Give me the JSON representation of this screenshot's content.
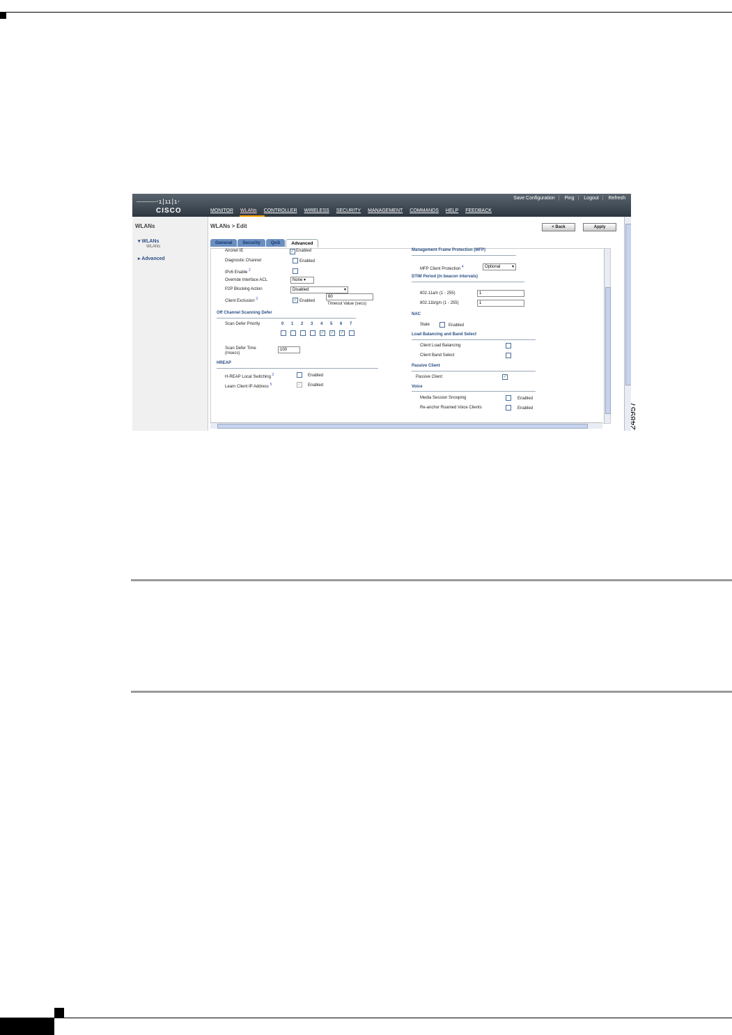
{
  "doc": {
    "figure_number": "248957"
  },
  "header": {
    "logo_bars": "·ı|ıı|ı·",
    "logo_text": "CISCO",
    "top_links": [
      "Save Configuration",
      "Ping",
      "Logout",
      "Refresh"
    ],
    "menu": [
      "MONITOR",
      "WLANs",
      "CONTROLLER",
      "WIRELESS",
      "SECURITY",
      "MANAGEMENT",
      "COMMANDS",
      "HELP",
      "FEEDBACK"
    ]
  },
  "sidebar": {
    "title": "WLANs",
    "items": [
      "WLANs",
      "WLANs",
      "Advanced"
    ]
  },
  "main": {
    "breadcrumb": "WLANs > Edit",
    "back_label": "< Back",
    "apply_label": "Apply",
    "tabs": [
      "General",
      "Security",
      "QoS",
      "Advanced"
    ]
  },
  "left": {
    "aironet": "Aironet IE",
    "aironet_val": "Enabled",
    "diag": "Diagnostic Channel",
    "diag_val": "Enabled",
    "ipv6": "IPv6 Enable",
    "ipv6_sup": "2",
    "override": "Override Interface ACL",
    "override_val": "None",
    "p2p": "P2P Blocking Action",
    "p2p_val": "Disabled",
    "client_excl": "Client Exclusion",
    "client_excl_sup": "3",
    "client_excl_val": "Enabled",
    "timeout_value": "60",
    "timeout_label": "Timeout Value (secs)",
    "off_channel": "Off Channel Scanning Defer",
    "scan_priority": "Scan Defer Priority",
    "priorities": [
      "0",
      "1",
      "2",
      "3",
      "4",
      "5",
      "6",
      "7"
    ],
    "priority_checked": [
      false,
      false,
      false,
      false,
      true,
      true,
      true,
      false
    ],
    "scan_time": "Scan Defer Time",
    "scan_time_unit": "(msecs)",
    "scan_time_val": "100",
    "hreap": "HREAP",
    "hreap_local": "H-REAP Local Switching",
    "hreap_local_sup": "2",
    "hreap_local_val": "Enabled",
    "learn_ip": "Learn Client IP Address",
    "learn_ip_sup": "5",
    "learn_ip_val": "Enabled"
  },
  "right": {
    "mfp": "Management Frame Protection (MFP)",
    "mfp_client": "MFP Client Protection",
    "mfp_sup": "4",
    "mfp_val": "Optional",
    "dtim": "DTIM Period (in beacon intervals)",
    "dtim_a": "802.11a/n (1 - 255)",
    "dtim_a_val": "1",
    "dtim_b": "802.11b/g/n (1 - 255)",
    "dtim_b_val": "1",
    "nac": "NAC",
    "nac_state": "State",
    "nac_val": "Enabled",
    "lb": "Load Balancing and Band Select",
    "clb": "Client Load Balancing",
    "cbs": "Client Band Select",
    "passive": "Passive Client",
    "passive_label": "Passive Client",
    "voice": "Voice",
    "media": "Media Session Snooping",
    "media_val": "Enabled",
    "reanchor": "Re-anchor Roamed Voice Clients",
    "reanchor_val": "Enabled"
  }
}
